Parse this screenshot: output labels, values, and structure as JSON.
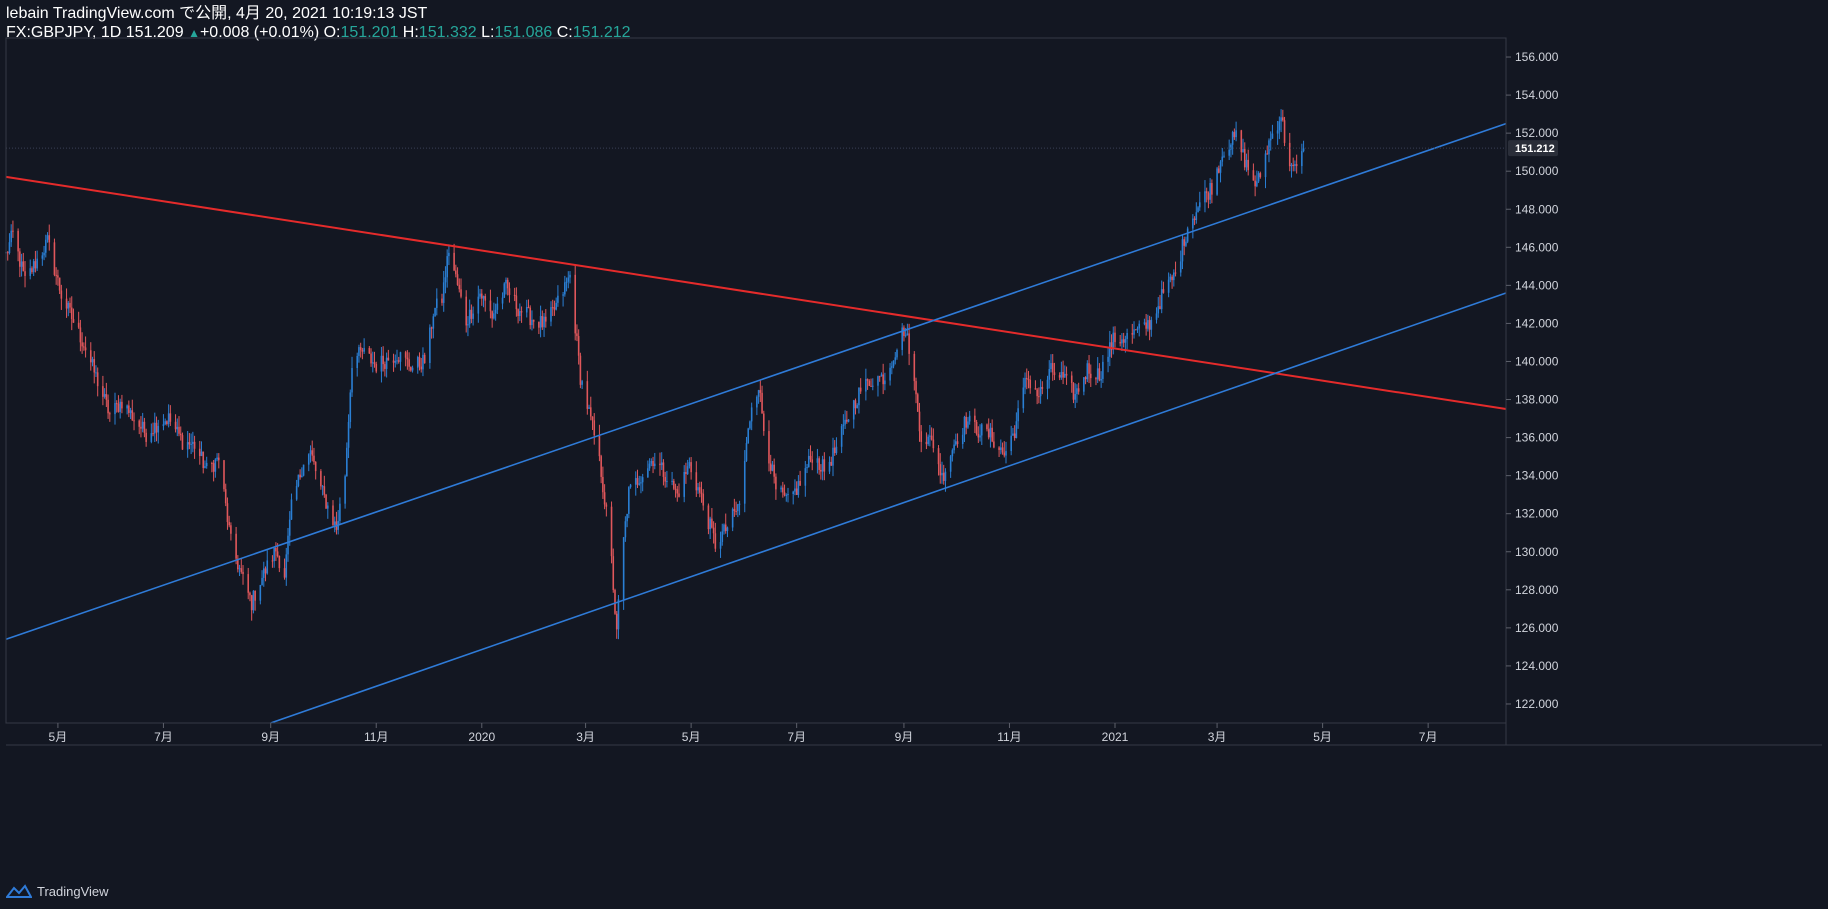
{
  "header": {
    "publish_line": "lebain TradingView.com で公開, 4月 20, 2021 10:19:13 JST",
    "symbol": "FX:GBPJPY, 1D",
    "last": "151.209",
    "arrow": "▲",
    "change": "+0.008 (+0.01%)",
    "o_label": "O:",
    "o_value": "151.201",
    "h_label": "H:",
    "h_value": "151.332",
    "l_label": "L:",
    "l_value": "151.086",
    "c_label": "C:",
    "c_value": "151.212"
  },
  "footer": {
    "brand": "TradingView"
  },
  "colors": {
    "background": "#131722",
    "up": "#2a7fd4",
    "down": "#e0575b",
    "trend_red": "#e52b2b",
    "channel_blue": "#2f7bd8",
    "axis_text": "#d1d4dc",
    "price_label_bg": "#2a2e39"
  },
  "chart_data": {
    "type": "candlestick",
    "symbol": "GBPJPY",
    "interval": "1D",
    "x_range": [
      "2019-04-01",
      "2021-08-15"
    ],
    "ylim": [
      121,
      157
    ],
    "grid": false,
    "y_ticks": [
      "122.000",
      "124.000",
      "126.000",
      "128.000",
      "130.000",
      "132.000",
      "134.000",
      "136.000",
      "138.000",
      "140.000",
      "142.000",
      "144.000",
      "146.000",
      "148.000",
      "150.000",
      "152.000",
      "154.000",
      "156.000"
    ],
    "x_ticks": [
      {
        "label": "5月",
        "date": "2019-05-01"
      },
      {
        "label": "7月",
        "date": "2019-07-01"
      },
      {
        "label": "9月",
        "date": "2019-09-01"
      },
      {
        "label": "11月",
        "date": "2019-11-01"
      },
      {
        "label": "2020",
        "date": "2020-01-01"
      },
      {
        "label": "3月",
        "date": "2020-03-01"
      },
      {
        "label": "5月",
        "date": "2020-05-01"
      },
      {
        "label": "7月",
        "date": "2020-07-01"
      },
      {
        "label": "9月",
        "date": "2020-09-01"
      },
      {
        "label": "11月",
        "date": "2020-11-01"
      },
      {
        "label": "2021",
        "date": "2021-01-01"
      },
      {
        "label": "3月",
        "date": "2021-03-01"
      },
      {
        "label": "5月",
        "date": "2021-05-01"
      },
      {
        "label": "7月",
        "date": "2021-07-01"
      }
    ],
    "last_price_label": "151.212",
    "last_price": 151.212,
    "key_points": [
      [
        "2019-04-01",
        145.6
      ],
      [
        "2019-04-05",
        146.7
      ],
      [
        "2019-04-12",
        144.2
      ],
      [
        "2019-04-25",
        146.3
      ],
      [
        "2019-05-03",
        143.5
      ],
      [
        "2019-05-17",
        140.7
      ],
      [
        "2019-05-31",
        137.2
      ],
      [
        "2019-06-07",
        137.9
      ],
      [
        "2019-06-14",
        137.0
      ],
      [
        "2019-06-21",
        136.2
      ],
      [
        "2019-06-28",
        136.8
      ],
      [
        "2019-07-04",
        137.0
      ],
      [
        "2019-07-12",
        135.8
      ],
      [
        "2019-07-19",
        135.6
      ],
      [
        "2019-07-26",
        134.3
      ],
      [
        "2019-08-02",
        134.9
      ],
      [
        "2019-08-09",
        130.5
      ],
      [
        "2019-08-16",
        128.5
      ],
      [
        "2019-08-21",
        127.3
      ],
      [
        "2019-08-25",
        128.3
      ],
      [
        "2019-08-31",
        129.4
      ],
      [
        "2019-09-04",
        130.1
      ],
      [
        "2019-09-09",
        128.8
      ],
      [
        "2019-09-13",
        132.3
      ],
      [
        "2019-09-20",
        134.8
      ],
      [
        "2019-09-24",
        135.2
      ],
      [
        "2019-09-30",
        133.3
      ],
      [
        "2019-10-09",
        131.2
      ],
      [
        "2019-10-14",
        134.1
      ],
      [
        "2019-10-18",
        140.0
      ],
      [
        "2019-10-24",
        140.5
      ],
      [
        "2019-11-01",
        139.8
      ],
      [
        "2019-11-13",
        140.4
      ],
      [
        "2019-11-22",
        139.7
      ],
      [
        "2019-11-30",
        140.1
      ],
      [
        "2019-12-04",
        142.6
      ],
      [
        "2019-12-09",
        143.3
      ],
      [
        "2019-12-13",
        145.9
      ],
      [
        "2019-12-23",
        142.1
      ],
      [
        "2019-12-31",
        143.6
      ],
      [
        "2020-01-07",
        142.4
      ],
      [
        "2020-01-15",
        143.9
      ],
      [
        "2020-01-22",
        142.8
      ],
      [
        "2020-01-31",
        142.2
      ],
      [
        "2020-02-07",
        141.9
      ],
      [
        "2020-02-14",
        143.1
      ],
      [
        "2020-02-21",
        144.5
      ],
      [
        "2020-02-27",
        139.2
      ],
      [
        "2020-03-02",
        137.7
      ],
      [
        "2020-03-06",
        136.1
      ],
      [
        "2020-03-10",
        134.2
      ],
      [
        "2020-03-13",
        132.0
      ],
      [
        "2020-03-16",
        129.5
      ],
      [
        "2020-03-19",
        125.6
      ],
      [
        "2020-03-21",
        128.9
      ],
      [
        "2020-03-26",
        133.1
      ],
      [
        "2020-04-01",
        133.9
      ],
      [
        "2020-04-09",
        134.9
      ],
      [
        "2020-04-16",
        134.1
      ],
      [
        "2020-04-23",
        133.0
      ],
      [
        "2020-04-30",
        134.6
      ],
      [
        "2020-05-07",
        132.8
      ],
      [
        "2020-05-15",
        130.4
      ],
      [
        "2020-05-22",
        131.3
      ],
      [
        "2020-05-29",
        132.5
      ],
      [
        "2020-06-05",
        137.8
      ],
      [
        "2020-06-09",
        138.8
      ],
      [
        "2020-06-12",
        136.5
      ],
      [
        "2020-06-19",
        133.2
      ],
      [
        "2020-06-26",
        132.6
      ],
      [
        "2020-07-03",
        133.6
      ],
      [
        "2020-07-10",
        135.1
      ],
      [
        "2020-07-17",
        134.3
      ],
      [
        "2020-07-24",
        135.4
      ],
      [
        "2020-07-31",
        137.2
      ],
      [
        "2020-08-07",
        138.5
      ],
      [
        "2020-08-14",
        139.1
      ],
      [
        "2020-08-21",
        139.2
      ],
      [
        "2020-08-28",
        140.8
      ],
      [
        "2020-09-01",
        141.7
      ],
      [
        "2020-09-04",
        140.8
      ],
      [
        "2020-09-11",
        136.1
      ],
      [
        "2020-09-18",
        135.7
      ],
      [
        "2020-09-23",
        133.9
      ],
      [
        "2020-09-30",
        135.7
      ],
      [
        "2020-10-07",
        136.9
      ],
      [
        "2020-10-14",
        136.4
      ],
      [
        "2020-10-21",
        136.1
      ],
      [
        "2020-10-29",
        135.1
      ],
      [
        "2020-11-04",
        136.4
      ],
      [
        "2020-11-11",
        139.2
      ],
      [
        "2020-11-18",
        138.2
      ],
      [
        "2020-11-25",
        139.5
      ],
      [
        "2020-12-02",
        139.1
      ],
      [
        "2020-12-09",
        138.2
      ],
      [
        "2020-12-16",
        139.6
      ],
      [
        "2020-12-23",
        139.3
      ],
      [
        "2020-12-31",
        141.1
      ],
      [
        "2021-01-08",
        141.3
      ],
      [
        "2021-01-15",
        141.6
      ],
      [
        "2021-01-22",
        142.1
      ],
      [
        "2021-01-29",
        143.6
      ],
      [
        "2021-02-05",
        144.6
      ],
      [
        "2021-02-12",
        147.1
      ],
      [
        "2021-02-19",
        148.3
      ],
      [
        "2021-02-26",
        149.2
      ],
      [
        "2021-03-05",
        151.2
      ],
      [
        "2021-03-12",
        151.8
      ],
      [
        "2021-03-19",
        150.1
      ],
      [
        "2021-03-24",
        149.2
      ],
      [
        "2021-03-31",
        151.5
      ],
      [
        "2021-04-07",
        153.0
      ],
      [
        "2021-04-10",
        151.1
      ],
      [
        "2021-04-14",
        150.0
      ],
      [
        "2021-04-18",
        150.3
      ],
      [
        "2021-04-20",
        151.2
      ]
    ],
    "trendlines": [
      {
        "name": "",
        "color": "#e52b2b",
        "p1": [
          "2019-04-01",
          149.7
        ],
        "p2": [
          "2021-08-15",
          137.5
        ]
      },
      {
        "name": "",
        "color": "#2f7bd8",
        "p1": [
          "2019-04-01",
          125.4
        ],
        "p2": [
          "2021-08-15",
          152.5
        ]
      },
      {
        "name": "",
        "color": "#2f7bd8",
        "p1": [
          "2019-09-01",
          121.0
        ],
        "p2": [
          "2021-08-15",
          143.6
        ]
      }
    ]
  }
}
